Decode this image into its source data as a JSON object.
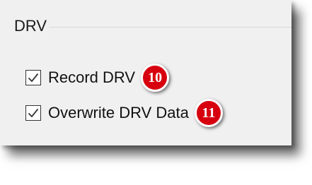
{
  "group": {
    "title": "DRV"
  },
  "options": [
    {
      "label": "Record DRV",
      "checked": true,
      "badge": "10"
    },
    {
      "label": "Overwrite DRV Data",
      "checked": true,
      "badge": "11"
    }
  ],
  "colors": {
    "badge": "#d7000f",
    "panel": "#f0f0f0",
    "text": "#111111"
  },
  "icons": {
    "check": "checkmark-icon"
  }
}
